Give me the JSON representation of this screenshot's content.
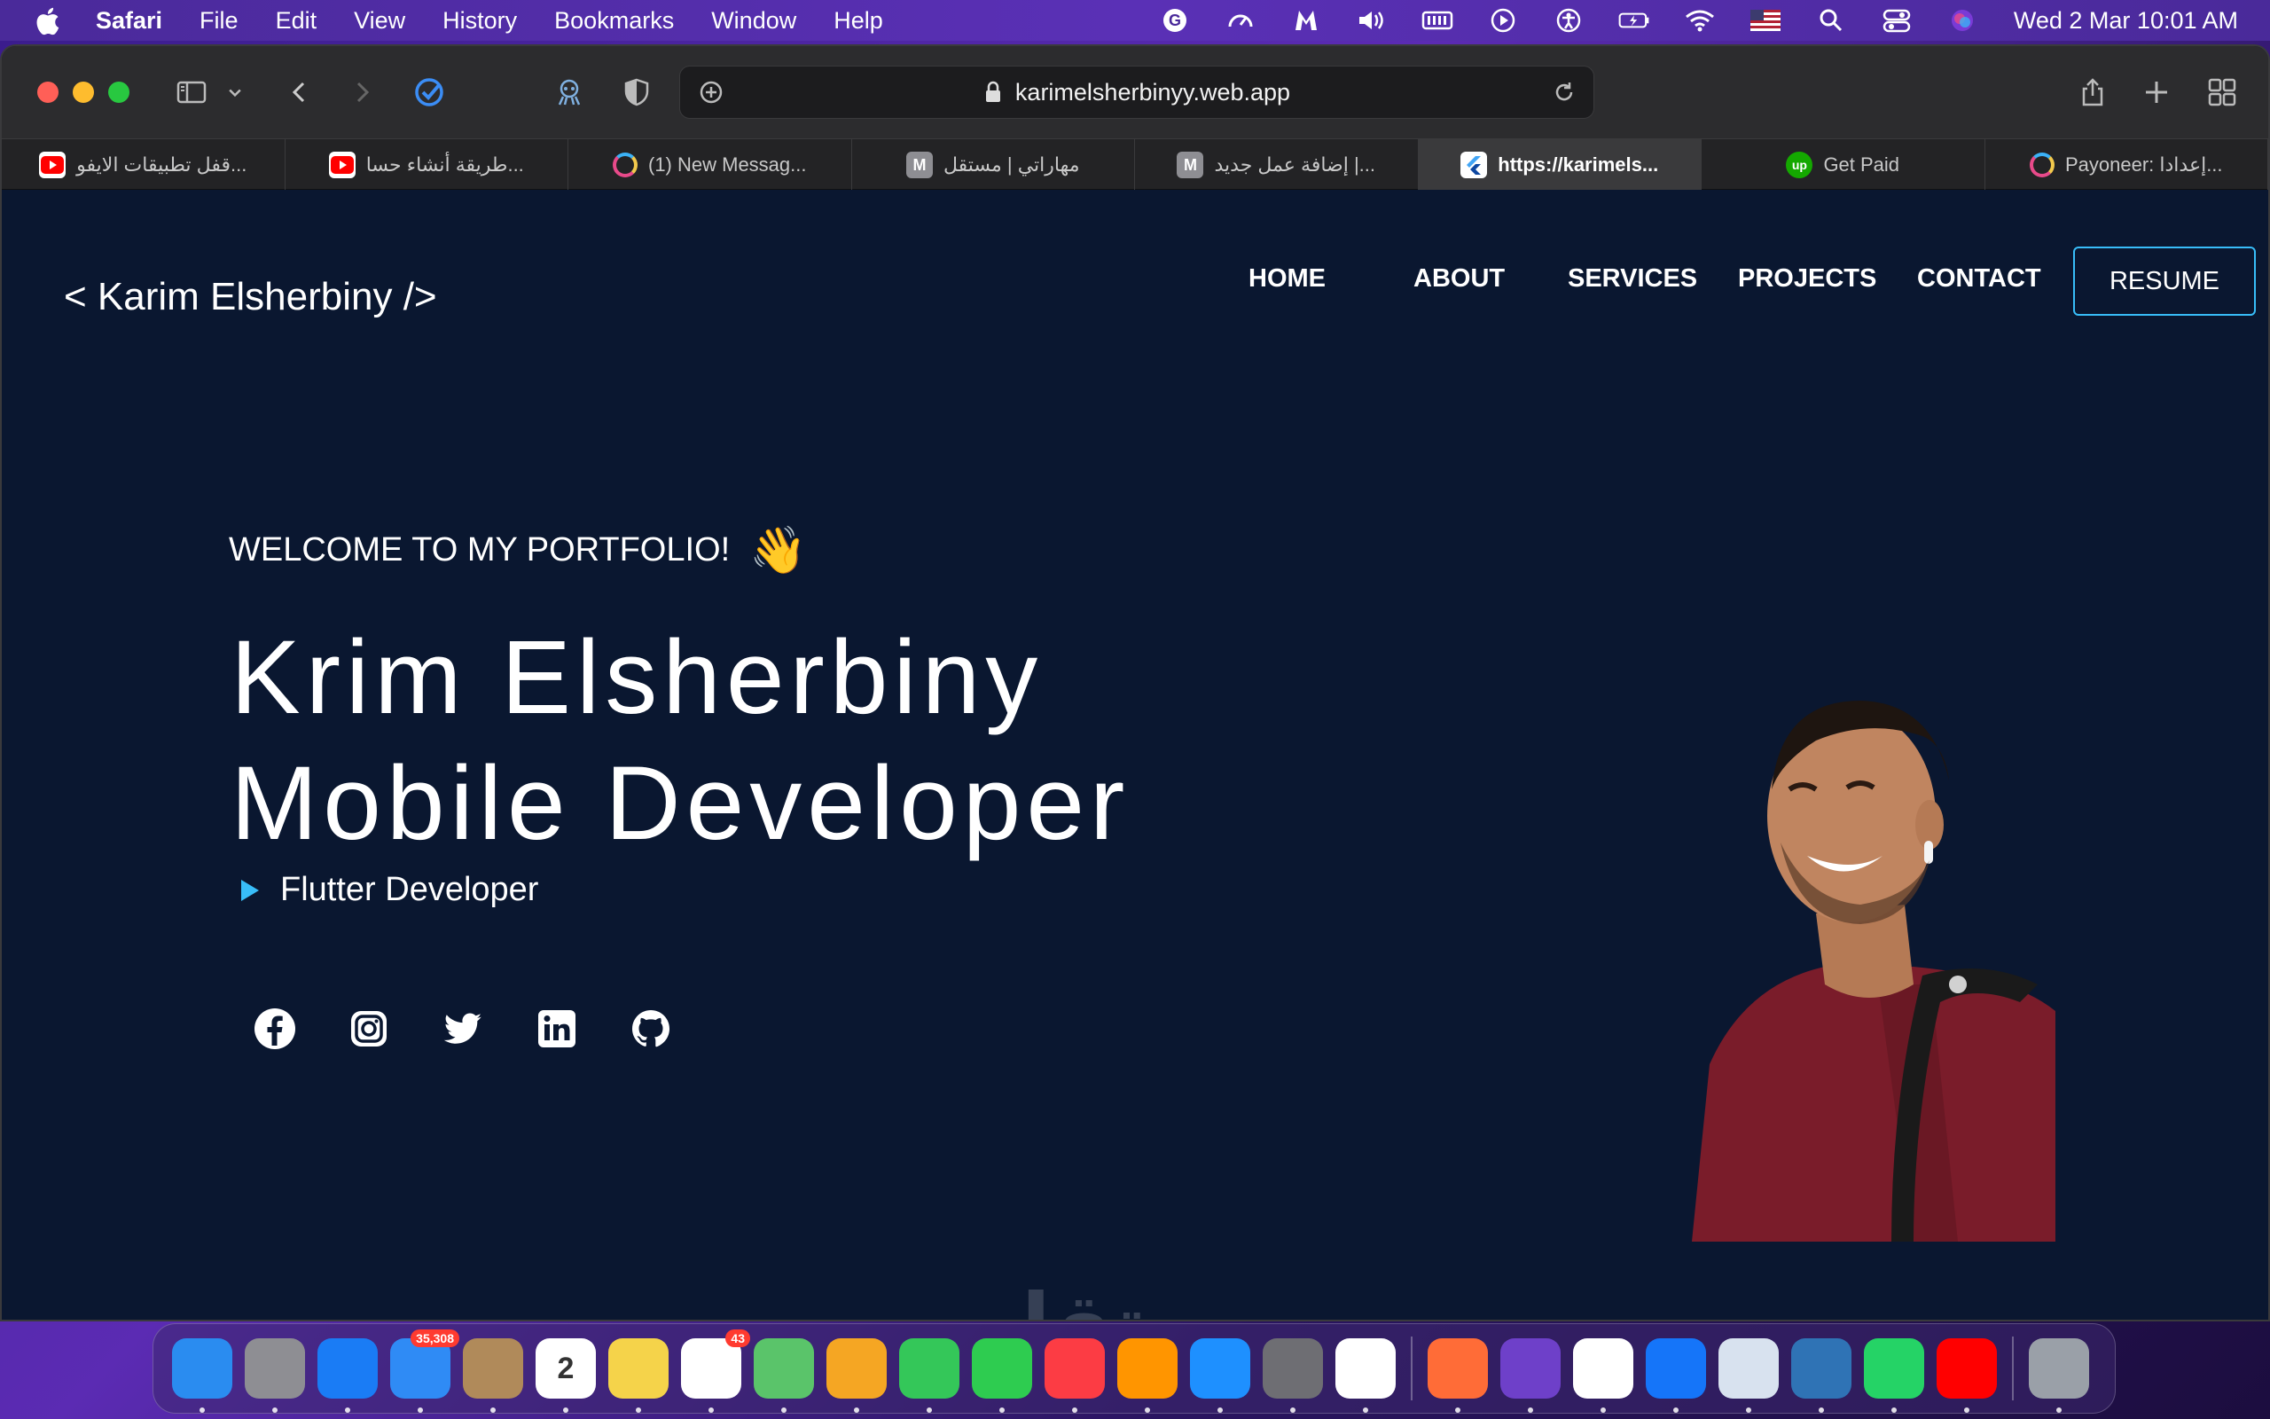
{
  "menubar": {
    "app_name": "Safari",
    "menus": [
      "File",
      "Edit",
      "View",
      "History",
      "Bookmarks",
      "Window",
      "Help"
    ],
    "clock": "Wed 2 Mar  10:01 AM",
    "status_icons": [
      "grammarly-icon",
      "speedometer-icon",
      "malwarebytes-icon",
      "volume-icon",
      "memory-icon",
      "play-icon",
      "accessibility-icon",
      "battery-charging-icon",
      "wifi-icon",
      "us-flag-icon",
      "spotlight-search-icon",
      "control-center-icon",
      "siri-icon"
    ]
  },
  "browser": {
    "url": "karimelsherbinyy.web.app",
    "tabs": [
      {
        "title": "قفل تطبيقات الايفو...",
        "favicon": "youtube"
      },
      {
        "title": "طريقة أنشاء حسا...",
        "favicon": "youtube"
      },
      {
        "title": "(1) New Messag...",
        "favicon": "ring"
      },
      {
        "title": "مهاراتي | مستقل",
        "favicon": "m"
      },
      {
        "title": "إضافة عمل جديد |...",
        "favicon": "m"
      },
      {
        "title": "https://karimels...",
        "favicon": "flutter",
        "active": true
      },
      {
        "title": "Get Paid",
        "favicon": "upwork"
      },
      {
        "title": "Payoneer: إعدادا...",
        "favicon": "ring"
      }
    ]
  },
  "site": {
    "brand": "< Karim Elsherbiny />",
    "nav": [
      "HOME",
      "ABOUT",
      "SERVICES",
      "PROJECTS",
      "CONTACT"
    ],
    "resume_label": "RESUME",
    "welcome": "WELCOME TO MY PORTFOLIO!",
    "wave_emoji": "👋",
    "name": "Krim Elsherbiny",
    "role": "Mobile Developer",
    "sub_role": "Flutter Developer",
    "socials": [
      "facebook-icon",
      "instagram-icon",
      "twitter-icon",
      "linkedin-icon",
      "github-icon"
    ],
    "accent_color": "#38bdf8",
    "bg_color": "#0a1730"
  },
  "watermark": "مستقل",
  "dock": {
    "apps": [
      {
        "name": "Finder",
        "color": "#2a8cf0"
      },
      {
        "name": "Launchpad",
        "color": "#8e8e93"
      },
      {
        "name": "Safari",
        "color": "#1a7cf5"
      },
      {
        "name": "Mail",
        "color": "#2f8bf5",
        "badge": "35,308"
      },
      {
        "name": "Contacts",
        "color": "#b08a5a"
      },
      {
        "name": "Calendar",
        "color": "#ffffff",
        "label": "2"
      },
      {
        "name": "Notes",
        "color": "#f5d34a"
      },
      {
        "name": "Reminders",
        "color": "#ffffff",
        "badge": "43"
      },
      {
        "name": "Maps",
        "color": "#5ac46a"
      },
      {
        "name": "Photos",
        "color": "#f5a623"
      },
      {
        "name": "Messages",
        "color": "#34c759"
      },
      {
        "name": "FaceTime",
        "color": "#2ecc50"
      },
      {
        "name": "Music",
        "color": "#fc3c44"
      },
      {
        "name": "Books",
        "color": "#ff9500"
      },
      {
        "name": "App Store",
        "color": "#1e90ff"
      },
      {
        "name": "System Preferences",
        "color": "#6e6e73"
      },
      {
        "name": "VS Code",
        "color": "#ffffff"
      },
      {
        "name": "Postman",
        "color": "#ff6c37"
      },
      {
        "name": "GitHub Desktop",
        "color": "#6e40c9"
      },
      {
        "name": "Chrome",
        "color": "#ffffff"
      },
      {
        "name": "Xcode",
        "color": "#1575f9"
      },
      {
        "name": "Preview",
        "color": "#d8e2ef"
      },
      {
        "name": "WordPress",
        "color": "#2f73b5"
      },
      {
        "name": "WhatsApp",
        "color": "#25d366"
      },
      {
        "name": "YouTube",
        "color": "#ff0000"
      },
      {
        "name": "Trash",
        "color": "#9aa0a8"
      }
    ]
  }
}
